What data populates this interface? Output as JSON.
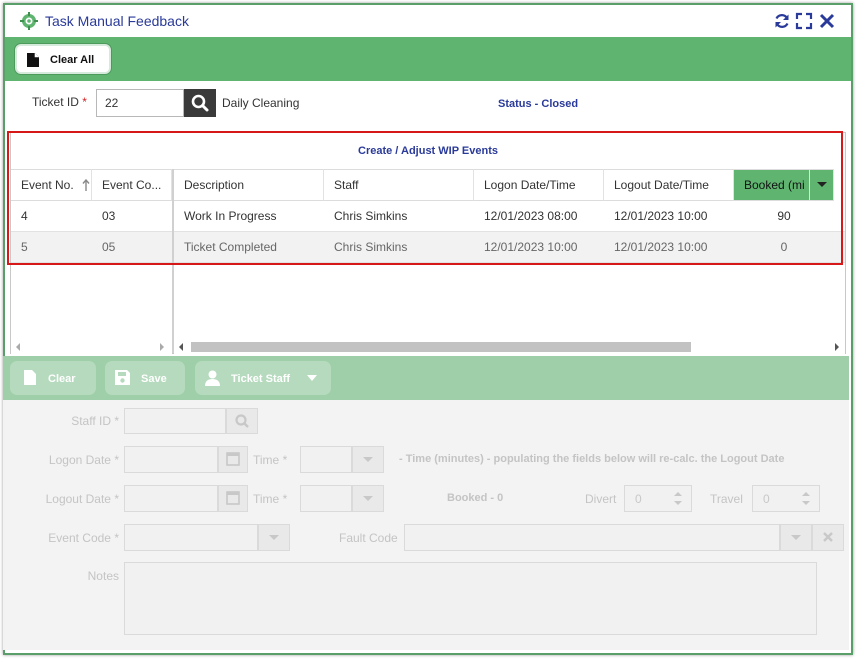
{
  "window": {
    "title": "Task Manual Feedback"
  },
  "toolbar": {
    "clear_all_label": "Clear All"
  },
  "ticket": {
    "label": "Ticket ID",
    "required_mark": "*",
    "value": "22",
    "description": "Daily Cleaning",
    "status_text": "Status -  Closed"
  },
  "grid": {
    "title": "Create / Adjust WIP Events",
    "columns": [
      "Event No.",
      "Event Co...",
      "Description",
      "Staff",
      "Logon Date/Time",
      "Logout Date/Time",
      "Booked (mi"
    ],
    "rows": [
      [
        "4",
        "03",
        "Work In Progress",
        "Chris Simkins",
        "12/01/2023 08:00",
        "12/01/2023 10:00",
        "90"
      ],
      [
        "5",
        "05",
        "Ticket Completed",
        "Chris Simkins",
        "12/01/2023 10:00",
        "12/01/2023 10:00",
        "0"
      ]
    ]
  },
  "actions": {
    "clear_label": "Clear",
    "save_label": "Save",
    "ticket_staff_label": "Ticket Staff"
  },
  "form": {
    "staff_id_label": "Staff ID",
    "logon_date_label": "Logon Date",
    "logout_date_label": "Logout Date",
    "time_label": "Time",
    "required_mark": "*",
    "time_hint": "- Time (minutes) - populating the fields below will re-calc. the Logout Date",
    "booked_text": "Booked - 0",
    "divert_label": "Divert",
    "divert_value": "0",
    "travel_label": "Travel",
    "travel_value": "0",
    "event_code_label": "Event Code",
    "fault_code_label": "Fault Code",
    "notes_label": "Notes"
  },
  "colors": {
    "accent_green": "#5fb570",
    "title_blue": "#2a3a9a",
    "highlight_red": "#d61818"
  }
}
